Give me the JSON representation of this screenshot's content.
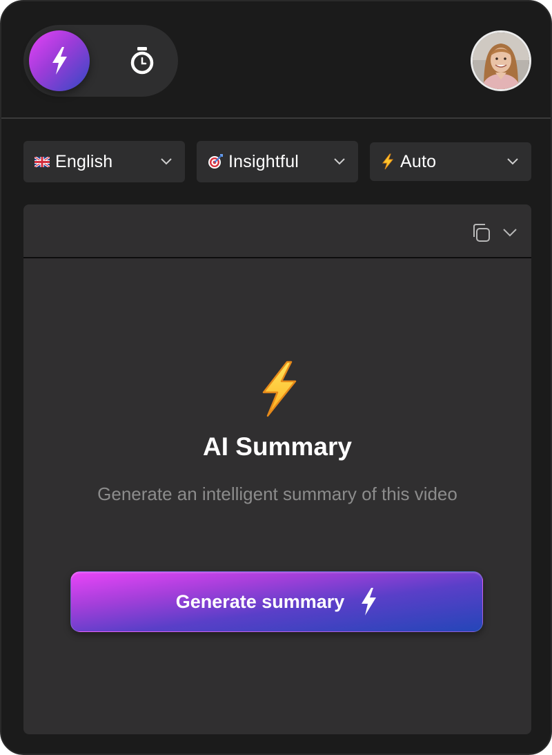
{
  "header": {
    "modes": [
      {
        "name": "summary",
        "icon": "lightning-bolt-icon",
        "active": true
      },
      {
        "name": "timer",
        "icon": "stopwatch-icon",
        "active": false
      }
    ],
    "avatar_icon": "user-avatar"
  },
  "selectors": [
    {
      "flag": "🇬🇧",
      "label": "English",
      "icon": "uk-flag-icon"
    },
    {
      "flag": "🎯",
      "label": "Insightful",
      "icon": "target-icon"
    },
    {
      "flag": "⚡",
      "label": "Auto",
      "icon": "lightning-icon"
    }
  ],
  "card": {
    "title": "AI Summary",
    "subtitle": "Generate an intelligent summary of this video",
    "button_label": "Generate summary"
  },
  "colors": {
    "background": "#1b1b1b",
    "surface": "#2e2e2f",
    "card": "#302f30",
    "accent_start": "#e843f7",
    "accent_end": "#2446b8",
    "muted_text": "#8c8c8c"
  }
}
